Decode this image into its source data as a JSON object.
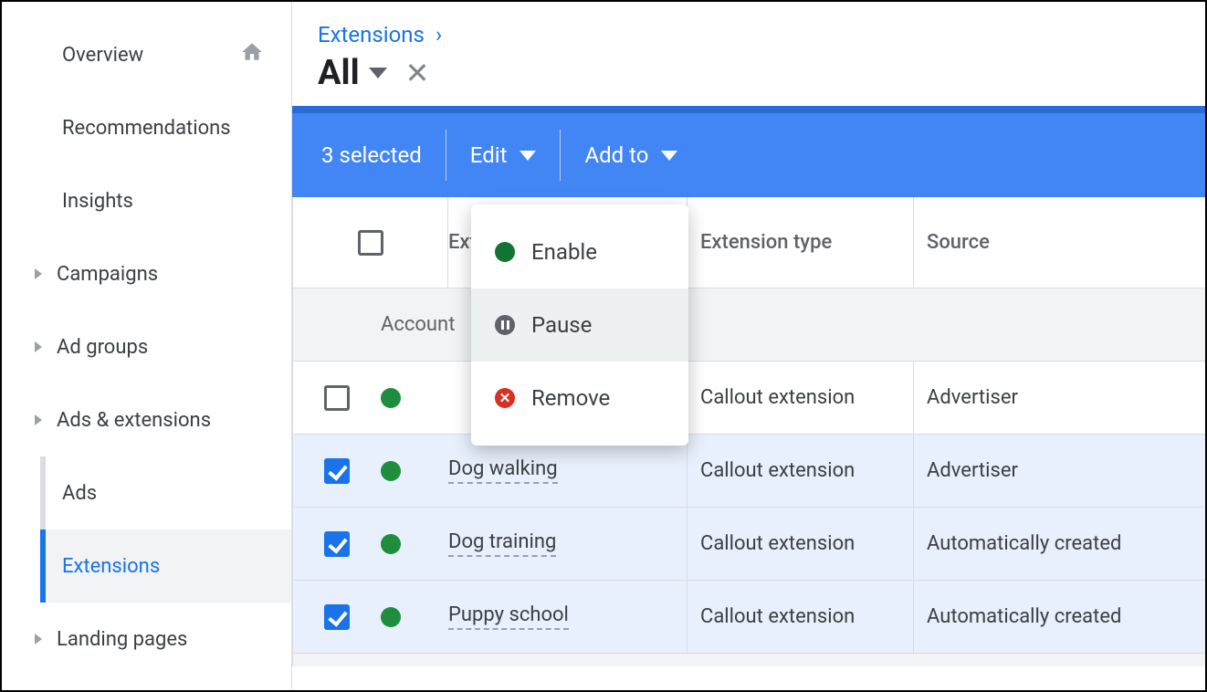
{
  "sidebar": {
    "items": [
      {
        "label": "Overview",
        "hasCaret": false,
        "hasHome": true
      },
      {
        "label": "Recommendations",
        "hasCaret": false
      },
      {
        "label": "Insights",
        "hasCaret": false
      },
      {
        "label": "Campaigns",
        "hasCaret": true
      },
      {
        "label": "Ad groups",
        "hasCaret": true
      },
      {
        "label": "Ads & extensions",
        "hasCaret": true,
        "children": [
          {
            "label": "Ads",
            "active": false
          },
          {
            "label": "Extensions",
            "active": true
          }
        ]
      },
      {
        "label": "Landing pages",
        "hasCaret": true
      }
    ]
  },
  "header": {
    "breadcrumb": "Extensions",
    "filter": "All"
  },
  "actionbar": {
    "selected_text": "3 selected",
    "edit_label": "Edit",
    "addto_label": "Add to"
  },
  "menu": {
    "enable": "Enable",
    "pause": "Pause",
    "remove": "Remove"
  },
  "table": {
    "headers": {
      "extension": "Extension",
      "type": "Extension type",
      "source": "Source"
    },
    "group_label": "Account",
    "rows": [
      {
        "checked": false,
        "extension": "",
        "type": "Callout extension",
        "source": "Advertiser"
      },
      {
        "checked": true,
        "extension": "Dog walking",
        "type": "Callout extension",
        "source": "Advertiser"
      },
      {
        "checked": true,
        "extension": "Dog training",
        "type": "Callout extension",
        "source": "Automatically created"
      },
      {
        "checked": true,
        "extension": "Puppy school",
        "type": "Callout extension",
        "source": "Automatically created"
      }
    ]
  }
}
